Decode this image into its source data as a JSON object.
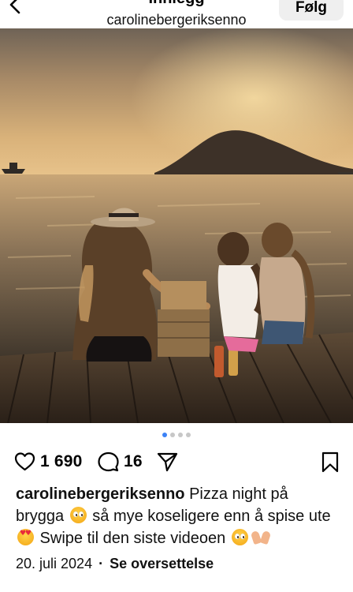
{
  "header": {
    "title": "Innlegg",
    "username": "carolinebergeriksenno",
    "follow_label": "Følg"
  },
  "post": {
    "image_icon": "photo",
    "carousel": {
      "count": 4,
      "active_index": 0
    },
    "likes": "1 690",
    "comments": "16",
    "caption": {
      "username": "carolinebergeriksenno",
      "line1": " Pizza night på brygga ",
      "line2": " så mye koseligere enn å spise ute ",
      "line3": " Swipe til den siste videoen "
    },
    "date": "20. juli 2024",
    "separator": "·",
    "translate_label": "Se oversettelse"
  },
  "icons": {
    "back": "chevron-left-icon",
    "like": "heart-icon",
    "comment": "comment-bubble-icon",
    "share": "paper-plane-icon",
    "save": "bookmark-icon"
  },
  "colors": {
    "accent_dot": "#3b82f6",
    "follow_bg": "#efefef"
  }
}
